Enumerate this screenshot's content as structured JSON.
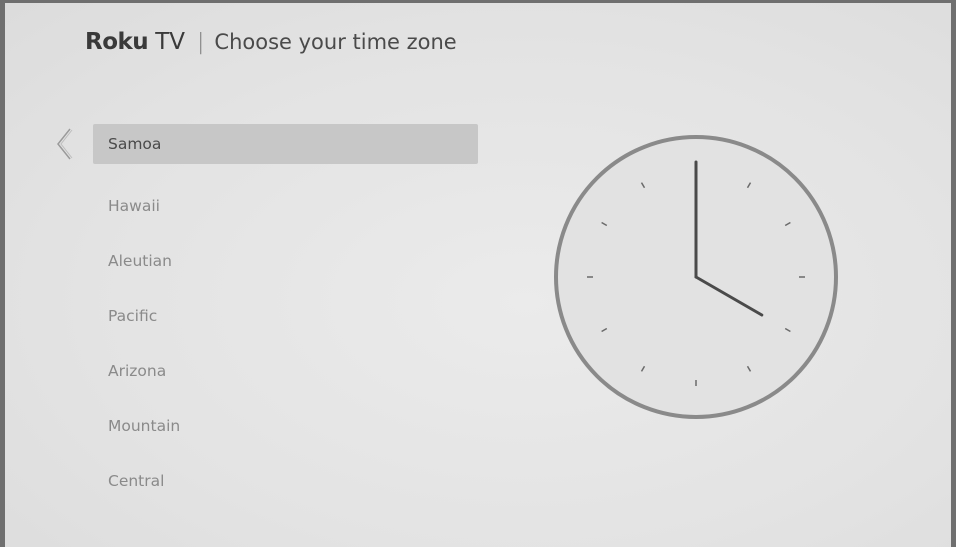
{
  "header": {
    "logo_brand": "Roku",
    "logo_product": "TV",
    "divider": "|",
    "title": "Choose your time zone"
  },
  "nav": {
    "back_icon": "chevron-left-icon"
  },
  "timezones": {
    "selected_index": 0,
    "items": [
      {
        "label": "Samoa"
      },
      {
        "label": "Hawaii"
      },
      {
        "label": "Aleutian"
      },
      {
        "label": "Pacific"
      },
      {
        "label": "Arizona"
      },
      {
        "label": "Mountain"
      },
      {
        "label": "Central"
      }
    ]
  },
  "clock": {
    "icon": "analog-clock-icon",
    "hour": 4,
    "minute": 0,
    "face_color": "#e2e2e2",
    "rim_color": "#8a8a8a",
    "hand_color": "#4a4a4a"
  }
}
